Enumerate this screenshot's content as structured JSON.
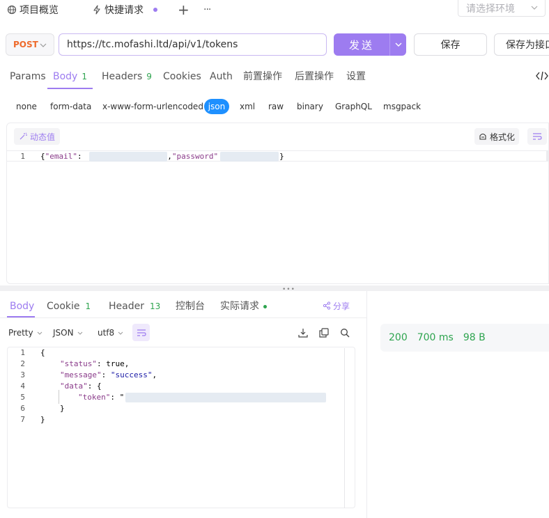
{
  "tabs": {
    "overview": "项目概览",
    "active": "快捷请求",
    "add": "+",
    "more": "···",
    "environment_placeholder": "请选择环境"
  },
  "request": {
    "method": "POST",
    "url": "https://tc.mofashi.ltd/api/v1/tokens",
    "send": "发送",
    "save": "保存",
    "save_as": "保存为接口"
  },
  "request_tabs": [
    {
      "label": "Params"
    },
    {
      "label": "Body",
      "count": "1"
    },
    {
      "label": "Headers",
      "count": "9"
    },
    {
      "label": "Cookies"
    },
    {
      "label": "Auth"
    },
    {
      "label": "前置操作"
    },
    {
      "label": "后置操作"
    },
    {
      "label": "设置"
    }
  ],
  "body_types": [
    "none",
    "form-data",
    "x-www-form-urlencoded",
    "json",
    "xml",
    "raw",
    "binary",
    "GraphQL",
    "msgpack"
  ],
  "editor": {
    "dynamic_value": "动态值",
    "format": "格式化",
    "line_number": "1",
    "code_open": "{",
    "key_email": "\"email\"",
    "sep_email": ": ",
    "mid": ",",
    "key_password": "\"password\"",
    "code_close": "}"
  },
  "response_tabs": [
    {
      "label": "Body"
    },
    {
      "label": "Cookie",
      "count": "1"
    },
    {
      "label": "Header",
      "count": "13"
    },
    {
      "label": "控制台"
    },
    {
      "label": "实际请求"
    }
  ],
  "share": "分享",
  "response_toolbar": {
    "view": "Pretty",
    "format": "JSON",
    "encoding": "utf8"
  },
  "response_code": {
    "line_numbers": [
      "1",
      "2",
      "3",
      "4",
      "5",
      "6",
      "7"
    ],
    "l1": "{",
    "l2_key": "\"status\"",
    "l2_rest": ": true,",
    "l3_key": "\"message\"",
    "l3_sep": ": ",
    "l3_val": "\"success\"",
    "l3_end": ",",
    "l4_key": "\"data\"",
    "l4_rest": ": {",
    "l5_key": "\"token\"",
    "l5_rest": ": \"",
    "l6": "}",
    "l7": "}"
  },
  "status": {
    "code": "200",
    "time": "700 ms",
    "size": "98 B"
  },
  "colors": {
    "accent": "#9d7cf0",
    "method": "#ee6a2b",
    "success": "#2ea44f",
    "json_pill": "#1e90ff"
  }
}
